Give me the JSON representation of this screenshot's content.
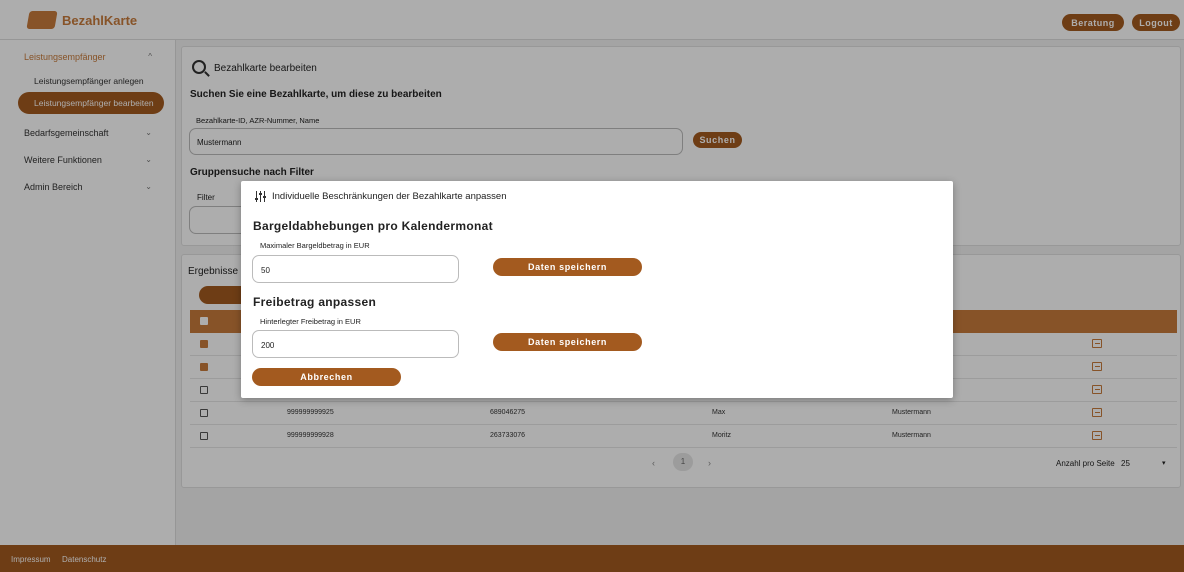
{
  "header": {
    "brand": "BezahlKarte",
    "beratung_label": "Beratung",
    "logout_label": "Logout"
  },
  "sidebar": {
    "groups": [
      {
        "label": "Leistungsempfänger",
        "chevron": "^",
        "items": [
          "Leistungsempfänger anlegen",
          "Leistungsempfänger bearbeiten"
        ]
      },
      {
        "label": "Bedarfsgemeinschaft",
        "chevron": "⌄"
      },
      {
        "label": "Weitere Funktionen",
        "chevron": "⌄"
      },
      {
        "label": "Admin Bereich",
        "chevron": "⌄"
      }
    ]
  },
  "main": {
    "page_title": "Bezahlkarte bearbeiten",
    "search_heading": "Suchen Sie eine Bezahlkarte, um diese zu bearbeiten",
    "search_label": "Bezahlkarte-ID, AZR-Nummer, Name",
    "search_value": "Mustermann",
    "search_button": "Suchen",
    "group_heading": "Gruppensuche nach Filter",
    "filter_label": "Filter",
    "results_label": "Ergebnisse",
    "rows": [
      {
        "checked": true,
        "id": "",
        "azr": "",
        "first": "",
        "last": ""
      },
      {
        "checked": true,
        "id": "",
        "azr": "",
        "first": "",
        "last": ""
      },
      {
        "checked": false,
        "id": "",
        "azr": "",
        "first": "",
        "last": ""
      },
      {
        "checked": false,
        "id": "999999999925",
        "azr": "689046275",
        "first": "Max",
        "last": "Mustermann"
      },
      {
        "checked": false,
        "id": "999999999928",
        "azr": "263733076",
        "first": "Moritz",
        "last": "Mustermann"
      }
    ],
    "pagination": {
      "prev": "‹",
      "page": "1",
      "next": "›"
    },
    "per_page_label": "Anzahl pro Seite",
    "per_page_value": "25"
  },
  "modal": {
    "title": "Individuelle Beschränkungen der Bezahlkarte anpassen",
    "section1_heading": "Bargeldabhebungen pro Kalendermonat",
    "section1_label": "Maximaler Bargeldbetrag in EUR",
    "section1_value": "50",
    "section1_button": "Daten speichern",
    "section2_heading": "Freibetrag anpassen",
    "section2_label": "Hinterlegter Freibetrag in EUR",
    "section2_value": "200",
    "section2_button": "Daten speichern",
    "cancel_button": "Abbrechen"
  },
  "footer": {
    "impressum": "Impressum",
    "datenschutz": "Datenschutz"
  },
  "colors": {
    "accent": "#c77b3b",
    "accent_dark": "#a35a1f"
  }
}
